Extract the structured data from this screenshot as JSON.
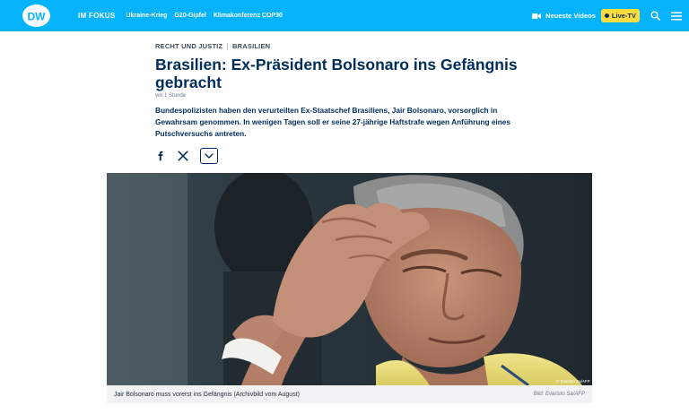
{
  "header": {
    "logo_text": "DW",
    "nav_focus": "IM FOKUS",
    "nav_items": [
      "Ukraine-Krieg",
      "G20-Gipfel",
      "Klimakonferenz COP30"
    ],
    "videos_label": "Neueste Videos",
    "live_label": "Live-TV",
    "colors": {
      "bar": "#05b2fc",
      "live": "#ffdc3e",
      "text": "#002d5a"
    }
  },
  "article": {
    "kicker_1": "RECHT UND JUSTIZ",
    "kicker_sep": "|",
    "kicker_2": "BRASILIEN",
    "headline": "Brasilien: Ex-Präsident Bolsonaro ins Gefängnis gebracht",
    "timestamp": "vor 1 Stunde",
    "lead": "Bundespolizisten haben den verurteilten Ex-Staatschef Brasiliens, Jair Bolsonaro, vorsorglich in Gewahrsam genommen. In wenigen Tagen soll er seine 27-jährige Haftstrafe wegen Anführung eines Putschversuchs antreten."
  },
  "share": {
    "icons": [
      "facebook-icon",
      "x-icon",
      "chevron-down-icon"
    ]
  },
  "image": {
    "caption": "Jair Bolsonaro muss vorerst ins Gefängnis (Archivbild vom August)",
    "credit": "Bild: Evaristo Sa/AFP",
    "copyright": "© Evaristo Sa/AFP"
  }
}
